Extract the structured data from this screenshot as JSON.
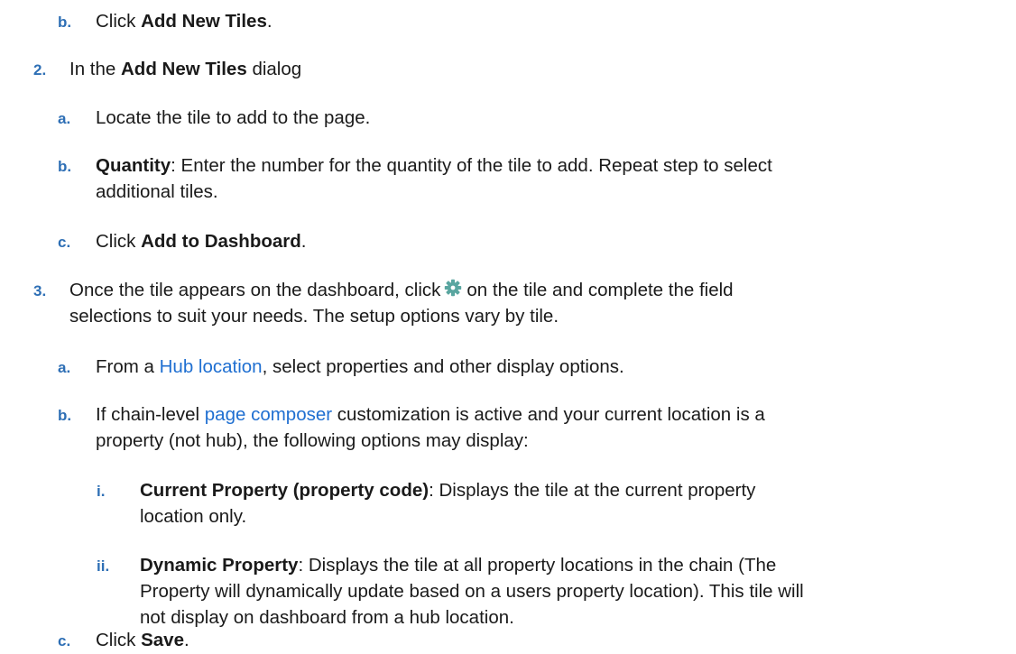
{
  "colors": {
    "marker": "#2e6fb5",
    "link": "#1f6fd1",
    "text": "#1a1a1a",
    "gear": "#5aa6a0"
  },
  "icons": {
    "settings": "gear-icon"
  },
  "step_1b": {
    "marker": "b.",
    "pre": "Click ",
    "bold": "Add New Tiles",
    "post": "."
  },
  "step_2": {
    "marker": "2.",
    "pre": "In the ",
    "bold": "Add New Tiles",
    "post": " dialog"
  },
  "step_2a": {
    "marker": "a.",
    "text": "Locate the tile to add to the page."
  },
  "step_2b": {
    "marker": "b.",
    "bold": "Quantity",
    "line1": ": Enter the number for the quantity of the tile to add. Repeat step to select",
    "line2": "additional tiles."
  },
  "step_2c": {
    "marker": "c.",
    "pre": "Click ",
    "bold": "Add to Dashboard",
    "post": "."
  },
  "step_3": {
    "marker": "3.",
    "line1_pre": "Once the tile appears on the dashboard, click",
    "line1_post": "on the tile and complete the field",
    "line2": "selections to suit your needs. The setup options vary by tile."
  },
  "step_3a": {
    "marker": "a.",
    "pre": "From a ",
    "link": "Hub location",
    "post": ", select properties and other display options."
  },
  "step_3b": {
    "marker": "b.",
    "pre": "If chain-level ",
    "link": "page composer",
    "line1_post": " customization is active and your current location is a",
    "line2": "property (not hub), the following options may display:"
  },
  "step_3b_i": {
    "marker": "i.",
    "bold": "Current Property (property code)",
    "line1": ": Displays the tile at the current property",
    "line2": "location only."
  },
  "step_3b_ii": {
    "marker": "ii.",
    "bold": "Dynamic Property",
    "line1": ": Displays the tile at all property locations in the chain (The",
    "line2": "Property will dynamically update based on a users property location). This tile will",
    "line3": "not display on dashboard from a hub location."
  },
  "step_3c": {
    "marker": "c.",
    "pre": "Click ",
    "bold": "Save",
    "post": "."
  }
}
